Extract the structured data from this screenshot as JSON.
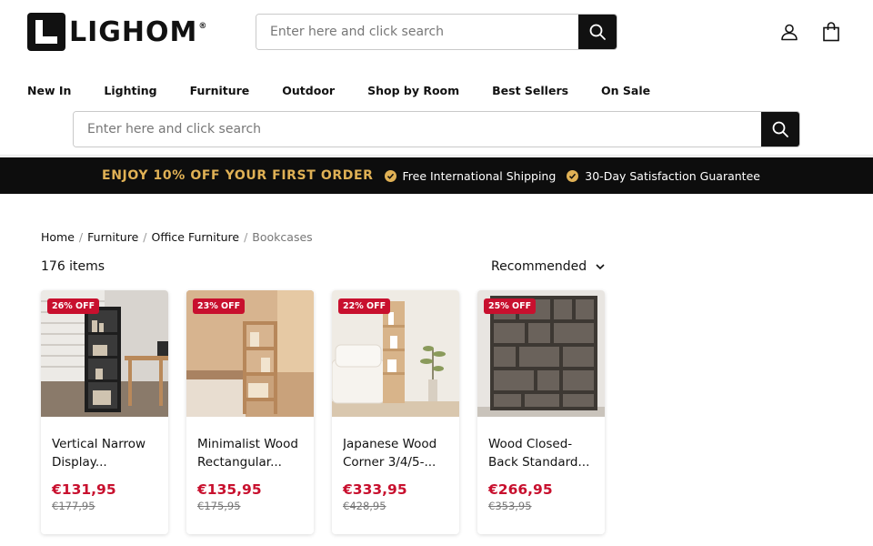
{
  "header": {
    "logo_text": "LIGHOM",
    "logo_reg": "®",
    "search_top_placeholder": "Enter here and click search",
    "search_mid_placeholder": "Enter here and click search",
    "icons": [
      "search-icon",
      "account-icon",
      "cart-icon"
    ]
  },
  "nav": {
    "items": [
      {
        "label": "New In"
      },
      {
        "label": "Lighting"
      },
      {
        "label": "Furniture"
      },
      {
        "label": "Outdoor"
      },
      {
        "label": "Shop by Room"
      },
      {
        "label": "Best Sellers"
      },
      {
        "label": "On Sale"
      }
    ]
  },
  "promo": {
    "main": "ENJOY 10% OFF YOUR FIRST ORDER",
    "item1": "Free International Shipping",
    "item2": "30-Day Satisfaction Guarantee",
    "accent_color": "#e0b155"
  },
  "breadcrumb": {
    "items": [
      "Home",
      "Furniture",
      "Office Furniture"
    ],
    "current": "Bookcases",
    "separator": "/"
  },
  "listing": {
    "count": "176 items",
    "sort_label": "Recommended"
  },
  "products": [
    {
      "badge": "26% OFF",
      "title": "Vertical Narrow Display...",
      "price": "€131,95",
      "old_price": "€177,95"
    },
    {
      "badge": "23% OFF",
      "title": "Minimalist Wood Rectangular...",
      "price": "€135,95",
      "old_price": "€175,95"
    },
    {
      "badge": "22% OFF",
      "title": "Japanese Wood Corner 3/4/5-...",
      "price": "€333,95",
      "old_price": "€428,95"
    },
    {
      "badge": "25% OFF",
      "title": "Wood Closed-Back Standard...",
      "price": "€266,95",
      "old_price": "€353,95"
    }
  ],
  "colors": {
    "sale_red": "#c8102e",
    "dark": "#0d0d0d"
  }
}
